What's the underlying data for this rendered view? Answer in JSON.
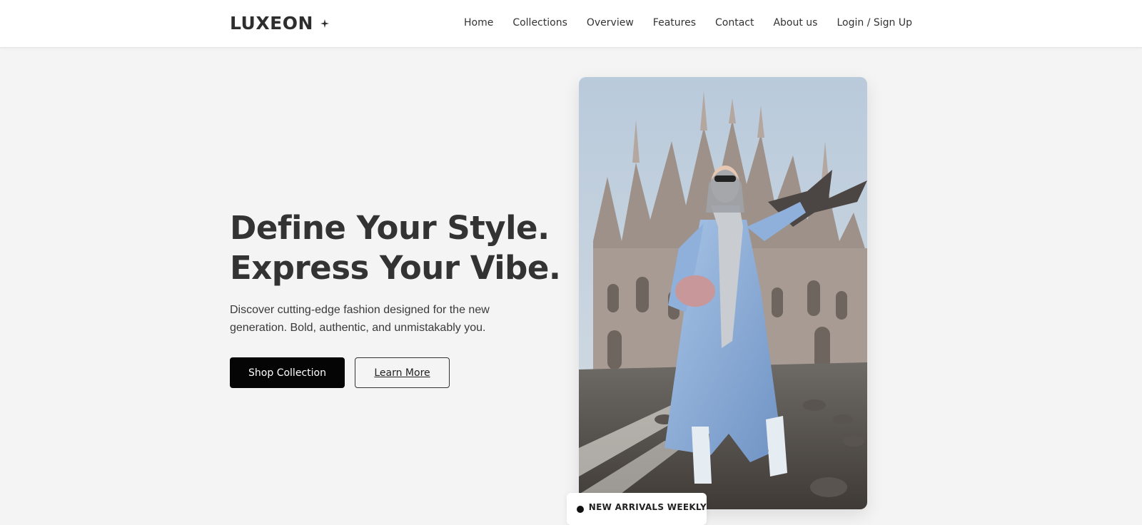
{
  "brand": {
    "name": "LUXEON",
    "icon": "sparkle-icon"
  },
  "nav": {
    "links": [
      "Home",
      "Collections",
      "Overview",
      "Features",
      "Contact",
      "About us",
      "Login / Sign Up"
    ]
  },
  "hero": {
    "headline_line1": "Define Your Style.",
    "headline_line2": "Express Your Vibe.",
    "subtext": "Discover cutting-edge fashion designed for the new generation. Bold, authentic, and unmistakably you.",
    "primary_button": "Shop Collection",
    "secondary_button": "Learn More",
    "image_alt": "Woman in a light blue coat posing in front of a gothic cathedral with pigeons"
  },
  "badge": {
    "text": "NEW ARRIVALS WEEKLY"
  },
  "colors": {
    "background": "#f4f4f4",
    "nav_background": "#ffffff",
    "text": "#333333",
    "primary_button": "#050505"
  }
}
